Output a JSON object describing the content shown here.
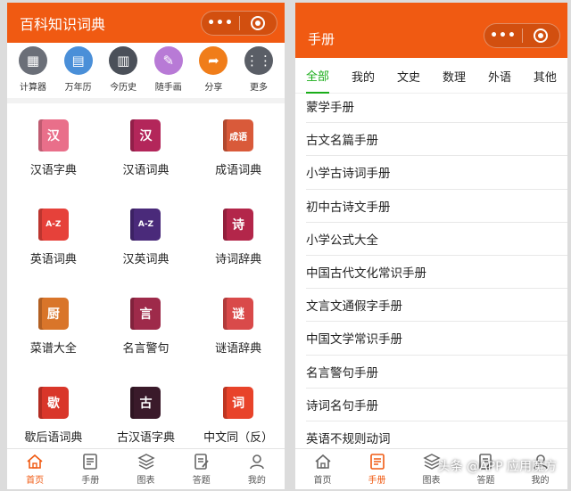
{
  "colors": {
    "accent": "#f05a12",
    "active_tab": "#1aad19"
  },
  "left": {
    "title": "百科知识词典",
    "tools": [
      {
        "label": "计算器",
        "icon": "calculator-icon",
        "color": "#6b6f78",
        "glyph": "▦"
      },
      {
        "label": "万年历",
        "icon": "calendar-icon",
        "color": "#4a8fd8",
        "glyph": "▤"
      },
      {
        "label": "今历史",
        "icon": "book-open-icon",
        "color": "#4b5059",
        "glyph": "▥"
      },
      {
        "label": "随手画",
        "icon": "pencil-icon",
        "color": "#b87ad6",
        "glyph": "✎"
      },
      {
        "label": "分享",
        "icon": "share-icon",
        "color": "#f07d1a",
        "glyph": "➦"
      },
      {
        "label": "更多",
        "icon": "more-grid-icon",
        "color": "#5a5e66",
        "glyph": "⋮⋮"
      }
    ],
    "grid": [
      {
        "label": "汉语字典",
        "icon": "hanyu-zidian-icon",
        "color": "#e96f8a",
        "glyph": "汉"
      },
      {
        "label": "汉语词典",
        "icon": "hanyu-cidian-icon",
        "color": "#b3265a",
        "glyph": "汉"
      },
      {
        "label": "成语词典",
        "icon": "chengyu-cidian-icon",
        "color": "#d95a3a",
        "glyph": "成语"
      },
      {
        "label": "英语词典",
        "icon": "english-dict-icon",
        "color": "#e6413a",
        "glyph": "A-Z"
      },
      {
        "label": "汉英词典",
        "icon": "chinese-english-dict-icon",
        "color": "#4a2a7a",
        "glyph": "A-Z"
      },
      {
        "label": "诗词辞典",
        "icon": "poetry-dict-icon",
        "color": "#b3264a",
        "glyph": "诗"
      },
      {
        "label": "菜谱大全",
        "icon": "recipe-icon",
        "color": "#d9752a",
        "glyph": "厨"
      },
      {
        "label": "名言警句",
        "icon": "quotes-icon",
        "color": "#9e2a4a",
        "glyph": "言"
      },
      {
        "label": "谜语辞典",
        "icon": "riddle-icon",
        "color": "#d94a4a",
        "glyph": "谜"
      },
      {
        "label": "歇后语词典",
        "icon": "xiehouyu-icon",
        "color": "#d9362a",
        "glyph": "歇"
      },
      {
        "label": "古汉语字典",
        "icon": "ancient-chinese-icon",
        "color": "#3a1a2a",
        "glyph": "古"
      },
      {
        "label": "中文同（反）",
        "icon": "synonym-icon",
        "color": "#e8432a",
        "glyph": "词"
      }
    ],
    "tabbar": [
      {
        "label": "首页",
        "icon": "home-icon",
        "active": true
      },
      {
        "label": "手册",
        "icon": "manual-icon",
        "active": false
      },
      {
        "label": "图表",
        "icon": "layers-icon",
        "active": false
      },
      {
        "label": "答题",
        "icon": "quiz-icon",
        "active": false
      },
      {
        "label": "我的",
        "icon": "user-icon",
        "active": false
      }
    ]
  },
  "right": {
    "title": "手册",
    "categories": [
      "全部",
      "我的",
      "文史",
      "数理",
      "外语",
      "其他"
    ],
    "active_category": 0,
    "items": [
      "蒙学手册",
      "古文名篇手册",
      "小学古诗词手册",
      "初中古诗文手册",
      "小学公式大全",
      "中国古代文化常识手册",
      "文言文通假字手册",
      "中国文学常识手册",
      "名言警句手册",
      "诗词名句手册",
      "英语不规则动词"
    ],
    "tabbar": [
      {
        "label": "首页",
        "icon": "home-icon",
        "active": false
      },
      {
        "label": "手册",
        "icon": "manual-icon",
        "active": true
      },
      {
        "label": "图表",
        "icon": "layers-icon",
        "active": false
      },
      {
        "label": "答题",
        "icon": "quiz-icon",
        "active": false
      },
      {
        "label": "我的",
        "icon": "user-icon",
        "active": false
      }
    ]
  },
  "watermark": "头条 @APP 应用魔方"
}
